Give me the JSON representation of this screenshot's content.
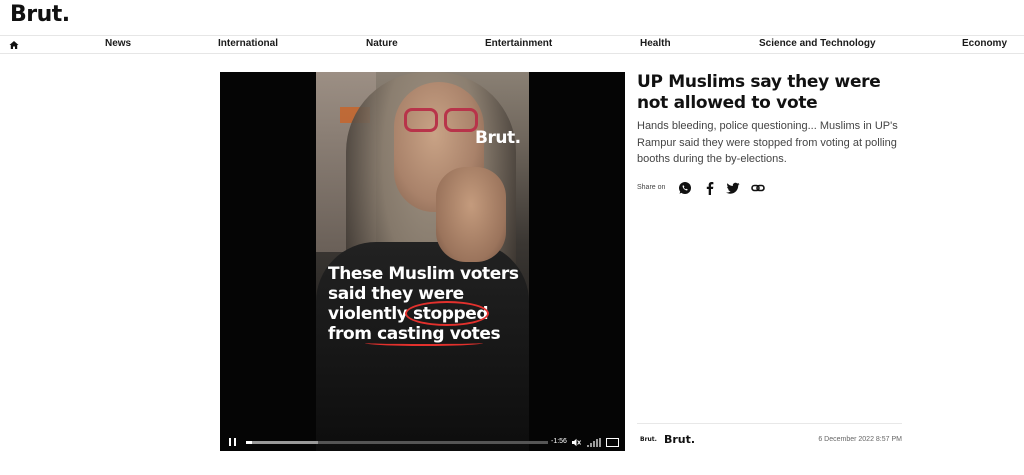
{
  "header": {
    "logo": "Brut."
  },
  "nav": {
    "items": [
      {
        "label": "News"
      },
      {
        "label": "International"
      },
      {
        "label": "Nature"
      },
      {
        "label": "Entertainment"
      },
      {
        "label": "Health"
      },
      {
        "label": "Science and Technology"
      },
      {
        "label": "Economy"
      }
    ]
  },
  "video": {
    "watermark": "Brut.",
    "caption_lines": [
      "These Muslim voters",
      "said they were",
      "violently stopped",
      "from casting votes"
    ],
    "time_remaining": "-1:56",
    "progress_fraction": 0.02,
    "buffered_fraction": 0.24
  },
  "article": {
    "title": "UP Muslims say they were not allowed to vote",
    "description": "Hands bleeding, police questioning... Muslims in UP's Rampur said they were stopped from voting at polling booths during the by-elections.",
    "share_label": "Share on",
    "share_icons": [
      "whatsapp-icon",
      "facebook-icon",
      "twitter-icon",
      "link-icon"
    ]
  },
  "footer": {
    "small_logo": "Brut.",
    "brand": "Brut.",
    "date": "6 December 2022 8:57 PM"
  }
}
